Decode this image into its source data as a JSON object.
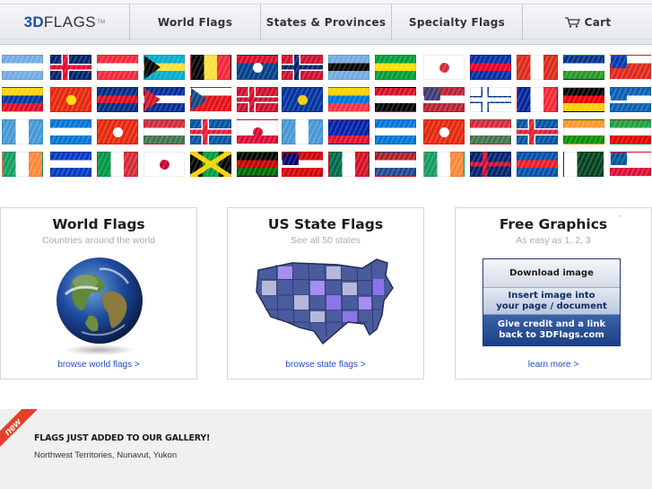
{
  "nav": {
    "logo_3d": "3D",
    "logo_flags": "FLAGS",
    "logo_tm": "TM",
    "items": [
      {
        "label": "World Flags"
      },
      {
        "label": "States & Provinces"
      },
      {
        "label": "Specialty Flags"
      },
      {
        "label": "Cart"
      }
    ]
  },
  "flag_rows": [
    [
      "argentina",
      "australia",
      "austria",
      "bahamas",
      "belgium",
      "belize",
      "bermuda",
      "botswana",
      "brazil",
      "south-korea",
      "cambodia",
      "canada",
      "central-african-rep",
      "chile"
    ],
    [
      "colombia",
      "china",
      "costa-rica",
      "cuba",
      "czech-republic",
      "denmark",
      "european-union",
      "ecuador",
      "egypt",
      "usa",
      "finland",
      "france",
      "germany",
      "greece"
    ],
    [
      "guatemala",
      "honduras",
      "hong-kong",
      "hungary",
      "iceland",
      "greenland",
      "guatemala-2",
      "haiti",
      "honduras-2",
      "hong-kong-2",
      "hungary-2",
      "iceland-2",
      "india",
      "iran"
    ],
    [
      "ireland",
      "israel",
      "italy",
      "japan",
      "jamaica",
      "kenya",
      "malaysia",
      "mexico",
      "netherlands",
      "ireland-2",
      "new-zealand",
      "north-korea",
      "pakistan",
      "panama"
    ]
  ],
  "cards": [
    {
      "title": "World Flags",
      "subtitle": "Countries around the world",
      "link": "browse world flags >"
    },
    {
      "title": "US State Flags",
      "subtitle": "See all 50 states",
      "link": "browse state flags >"
    },
    {
      "title": "Free Graphics",
      "subtitle": "As easy as 1, 2, 3",
      "link": "learn more >",
      "mark": "*",
      "steps": [
        "Download image",
        "Insert image into\nyour page / document",
        "Give credit and a link\nback to 3DFlags.com"
      ]
    }
  ],
  "gallery": {
    "badge": "new",
    "title": "FLAGS JUST ADDED TO OUR GALLERY!",
    "list": "Northwest Territories, Nunavut, Yukon"
  },
  "colors": {
    "accent_blue": "#1f4fa3",
    "link_blue": "#1f4fc9",
    "badge_red": "#e2402a"
  }
}
